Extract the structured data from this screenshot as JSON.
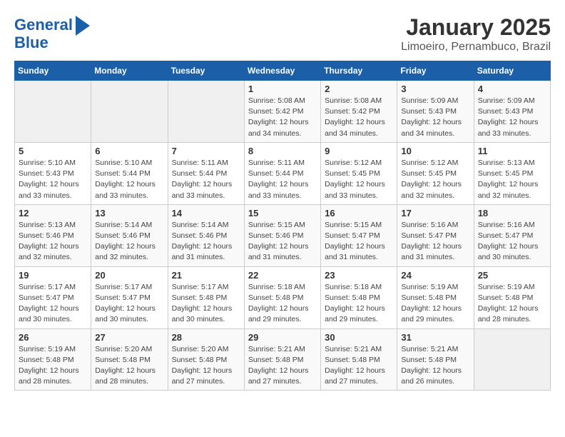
{
  "app": {
    "logo_line1": "General",
    "logo_line2": "Blue"
  },
  "title": "January 2025",
  "subtitle": "Limoeiro, Pernambuco, Brazil",
  "weekdays": [
    "Sunday",
    "Monday",
    "Tuesday",
    "Wednesday",
    "Thursday",
    "Friday",
    "Saturday"
  ],
  "weeks": [
    [
      {
        "day": "",
        "info": ""
      },
      {
        "day": "",
        "info": ""
      },
      {
        "day": "",
        "info": ""
      },
      {
        "day": "1",
        "info": "Sunrise: 5:08 AM\nSunset: 5:42 PM\nDaylight: 12 hours\nand 34 minutes."
      },
      {
        "day": "2",
        "info": "Sunrise: 5:08 AM\nSunset: 5:42 PM\nDaylight: 12 hours\nand 34 minutes."
      },
      {
        "day": "3",
        "info": "Sunrise: 5:09 AM\nSunset: 5:43 PM\nDaylight: 12 hours\nand 34 minutes."
      },
      {
        "day": "4",
        "info": "Sunrise: 5:09 AM\nSunset: 5:43 PM\nDaylight: 12 hours\nand 33 minutes."
      }
    ],
    [
      {
        "day": "5",
        "info": "Sunrise: 5:10 AM\nSunset: 5:43 PM\nDaylight: 12 hours\nand 33 minutes."
      },
      {
        "day": "6",
        "info": "Sunrise: 5:10 AM\nSunset: 5:44 PM\nDaylight: 12 hours\nand 33 minutes."
      },
      {
        "day": "7",
        "info": "Sunrise: 5:11 AM\nSunset: 5:44 PM\nDaylight: 12 hours\nand 33 minutes."
      },
      {
        "day": "8",
        "info": "Sunrise: 5:11 AM\nSunset: 5:44 PM\nDaylight: 12 hours\nand 33 minutes."
      },
      {
        "day": "9",
        "info": "Sunrise: 5:12 AM\nSunset: 5:45 PM\nDaylight: 12 hours\nand 33 minutes."
      },
      {
        "day": "10",
        "info": "Sunrise: 5:12 AM\nSunset: 5:45 PM\nDaylight: 12 hours\nand 32 minutes."
      },
      {
        "day": "11",
        "info": "Sunrise: 5:13 AM\nSunset: 5:45 PM\nDaylight: 12 hours\nand 32 minutes."
      }
    ],
    [
      {
        "day": "12",
        "info": "Sunrise: 5:13 AM\nSunset: 5:46 PM\nDaylight: 12 hours\nand 32 minutes."
      },
      {
        "day": "13",
        "info": "Sunrise: 5:14 AM\nSunset: 5:46 PM\nDaylight: 12 hours\nand 32 minutes."
      },
      {
        "day": "14",
        "info": "Sunrise: 5:14 AM\nSunset: 5:46 PM\nDaylight: 12 hours\nand 31 minutes."
      },
      {
        "day": "15",
        "info": "Sunrise: 5:15 AM\nSunset: 5:46 PM\nDaylight: 12 hours\nand 31 minutes."
      },
      {
        "day": "16",
        "info": "Sunrise: 5:15 AM\nSunset: 5:47 PM\nDaylight: 12 hours\nand 31 minutes."
      },
      {
        "day": "17",
        "info": "Sunrise: 5:16 AM\nSunset: 5:47 PM\nDaylight: 12 hours\nand 31 minutes."
      },
      {
        "day": "18",
        "info": "Sunrise: 5:16 AM\nSunset: 5:47 PM\nDaylight: 12 hours\nand 30 minutes."
      }
    ],
    [
      {
        "day": "19",
        "info": "Sunrise: 5:17 AM\nSunset: 5:47 PM\nDaylight: 12 hours\nand 30 minutes."
      },
      {
        "day": "20",
        "info": "Sunrise: 5:17 AM\nSunset: 5:47 PM\nDaylight: 12 hours\nand 30 minutes."
      },
      {
        "day": "21",
        "info": "Sunrise: 5:17 AM\nSunset: 5:48 PM\nDaylight: 12 hours\nand 30 minutes."
      },
      {
        "day": "22",
        "info": "Sunrise: 5:18 AM\nSunset: 5:48 PM\nDaylight: 12 hours\nand 29 minutes."
      },
      {
        "day": "23",
        "info": "Sunrise: 5:18 AM\nSunset: 5:48 PM\nDaylight: 12 hours\nand 29 minutes."
      },
      {
        "day": "24",
        "info": "Sunrise: 5:19 AM\nSunset: 5:48 PM\nDaylight: 12 hours\nand 29 minutes."
      },
      {
        "day": "25",
        "info": "Sunrise: 5:19 AM\nSunset: 5:48 PM\nDaylight: 12 hours\nand 28 minutes."
      }
    ],
    [
      {
        "day": "26",
        "info": "Sunrise: 5:19 AM\nSunset: 5:48 PM\nDaylight: 12 hours\nand 28 minutes."
      },
      {
        "day": "27",
        "info": "Sunrise: 5:20 AM\nSunset: 5:48 PM\nDaylight: 12 hours\nand 28 minutes."
      },
      {
        "day": "28",
        "info": "Sunrise: 5:20 AM\nSunset: 5:48 PM\nDaylight: 12 hours\nand 27 minutes."
      },
      {
        "day": "29",
        "info": "Sunrise: 5:21 AM\nSunset: 5:48 PM\nDaylight: 12 hours\nand 27 minutes."
      },
      {
        "day": "30",
        "info": "Sunrise: 5:21 AM\nSunset: 5:48 PM\nDaylight: 12 hours\nand 27 minutes."
      },
      {
        "day": "31",
        "info": "Sunrise: 5:21 AM\nSunset: 5:48 PM\nDaylight: 12 hours\nand 26 minutes."
      },
      {
        "day": "",
        "info": ""
      }
    ]
  ]
}
